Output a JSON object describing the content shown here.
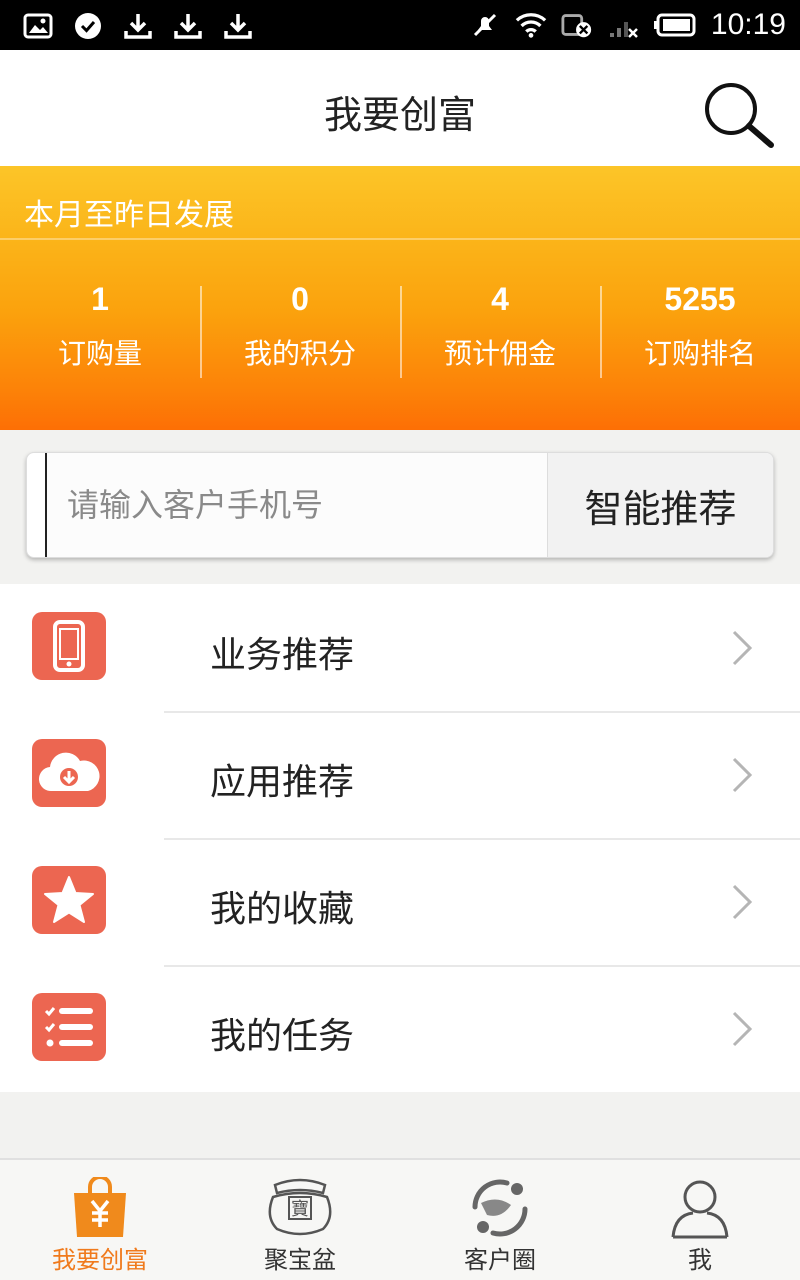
{
  "status_bar": {
    "time": "10:19",
    "left_icons": [
      "image-icon",
      "check-icon",
      "download-icon",
      "download-icon",
      "download-icon"
    ],
    "right_icons": [
      "mute-icon",
      "wifi-icon",
      "sim-icon",
      "signal-icon",
      "battery-icon"
    ]
  },
  "header": {
    "title": "我要创富",
    "search_icon": "search-icon"
  },
  "stats": {
    "title": "本月至昨日发展",
    "items": [
      {
        "value": "1",
        "label": "订购量"
      },
      {
        "value": "0",
        "label": "我的积分"
      },
      {
        "value": "4",
        "label": "预计佣金"
      },
      {
        "value": "5255",
        "label": "订购排名"
      }
    ]
  },
  "search": {
    "placeholder": "请输入客户手机号",
    "button_label": "智能推荐"
  },
  "menu": {
    "items": [
      {
        "label": "业务推荐",
        "icon": "phone-icon"
      },
      {
        "label": "应用推荐",
        "icon": "cloud-download-icon"
      },
      {
        "label": "我的收藏",
        "icon": "star-icon"
      },
      {
        "label": "我的任务",
        "icon": "checklist-icon"
      }
    ]
  },
  "bottom_nav": {
    "items": [
      {
        "label": "我要创富",
        "icon": "shopping-bag-icon",
        "active": true
      },
      {
        "label": "聚宝盆",
        "icon": "treasure-pot-icon",
        "active": false
      },
      {
        "label": "客户圈",
        "icon": "customer-circle-icon",
        "active": false
      },
      {
        "label": "我",
        "icon": "user-icon",
        "active": false
      }
    ]
  },
  "colors": {
    "accent": "#f07a1c",
    "icon_bg": "#ec6651",
    "stats_gradient_top": "#fcc528",
    "stats_gradient_bottom": "#fd6f05"
  }
}
